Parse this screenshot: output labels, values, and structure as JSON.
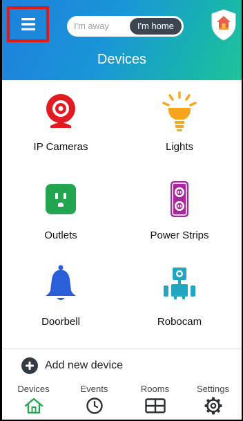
{
  "header": {
    "mode_toggle": {
      "away_label": "I'm away",
      "home_label": "I'm home",
      "selected": "home"
    },
    "title": "Devices"
  },
  "devices": [
    {
      "label": "IP Cameras",
      "icon": "camera-icon",
      "color": "#e01b22"
    },
    {
      "label": "Lights",
      "icon": "light-bulb-icon",
      "color": "#f7a51c"
    },
    {
      "label": "Outlets",
      "icon": "outlet-icon",
      "color": "#23a450"
    },
    {
      "label": "Power Strips",
      "icon": "power-strip-icon",
      "color": "#a8299e"
    },
    {
      "label": "Doorbell",
      "icon": "bell-icon",
      "color": "#2b5fd9"
    },
    {
      "label": "Robocam",
      "icon": "robot-icon",
      "color": "#23a6c2"
    }
  ],
  "add_device": {
    "label": "Add new device",
    "icon": "plus-circle-icon"
  },
  "tabs": [
    {
      "label": "Devices",
      "icon": "home-icon",
      "active": true
    },
    {
      "label": "Events",
      "icon": "clock-icon",
      "active": false
    },
    {
      "label": "Rooms",
      "icon": "rooms-grid-icon",
      "active": false
    },
    {
      "label": "Settings",
      "icon": "gear-icon",
      "active": false
    }
  ],
  "colors": {
    "header_gradient_start": "#1e7fdc",
    "header_gradient_end": "#1fc39a",
    "active_tab": "#23a450",
    "highlight_border": "#e01919"
  }
}
